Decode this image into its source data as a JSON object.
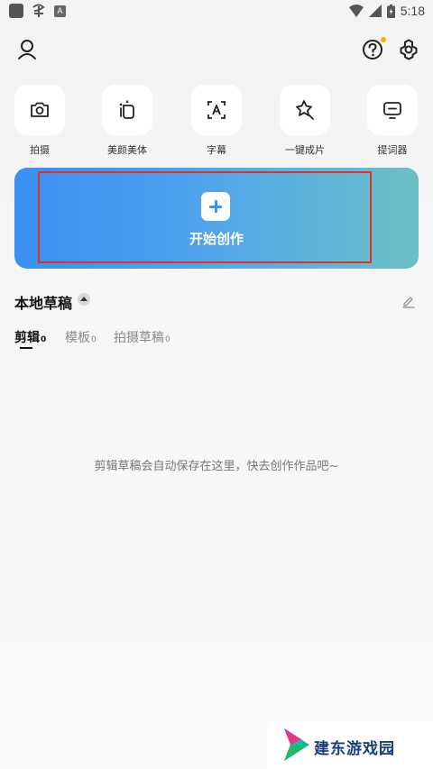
{
  "status_bar": {
    "time": "5:18",
    "left_icons": [
      "app-square-icon",
      "ribbon-icon",
      "a-icon"
    ],
    "right_icons": [
      "wifi-icon",
      "signal-icon",
      "battery-icon"
    ]
  },
  "header": {
    "profile_icon": "user-icon",
    "help_icon": "help-icon",
    "settings_icon": "gear-icon",
    "notification_dot_color": "#f5b500"
  },
  "tools": [
    {
      "label": "拍摄",
      "icon": "camera-icon"
    },
    {
      "label": "美颜美体",
      "icon": "beauty-icon"
    },
    {
      "label": "字幕",
      "icon": "subtitle-icon"
    },
    {
      "label": "一键成片",
      "icon": "magic-icon"
    },
    {
      "label": "提词器",
      "icon": "teleprompter-icon"
    }
  ],
  "banner": {
    "label": "开始创作",
    "icon": "plus-icon",
    "highlight_color": "#d9342b"
  },
  "drafts": {
    "title": "本地草稿",
    "tabs": [
      {
        "label": "剪辑",
        "count": "0",
        "active": true
      },
      {
        "label": "模板",
        "count": "0",
        "active": false
      },
      {
        "label": "拍摄草稿",
        "count": "0",
        "active": false
      }
    ],
    "empty_message": "剪辑草稿会自动保存在这里，快去创作作品吧~"
  },
  "watermark": {
    "text": "建东游戏园"
  }
}
